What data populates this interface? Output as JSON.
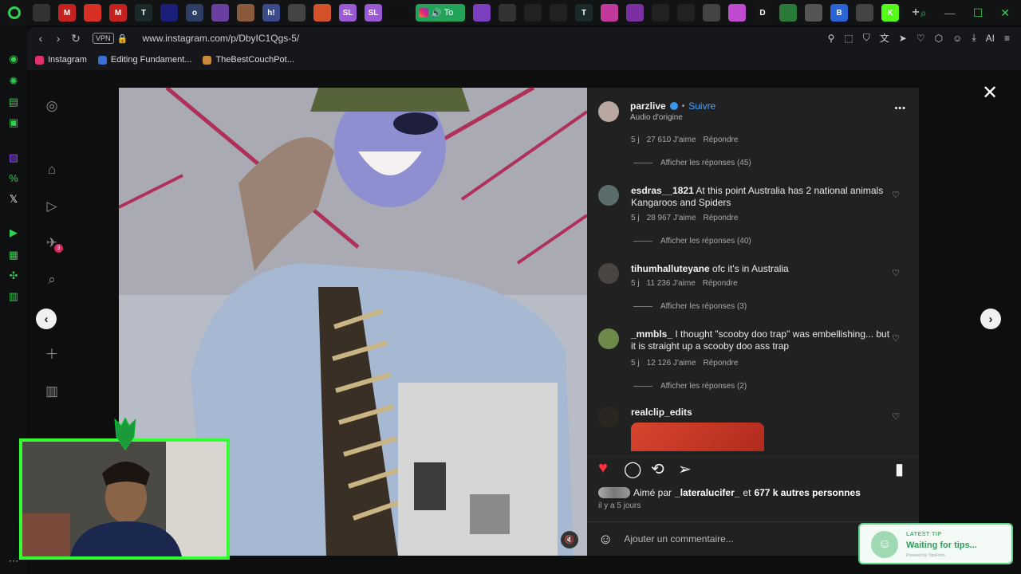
{
  "browser": {
    "url": "www.instagram.com/p/DbyIC1Qgs-5/",
    "vpn_label": "VPN",
    "ai_label": "AI",
    "active_tab_label": "To",
    "bookmarks": [
      {
        "label": "Instagram",
        "color": "#e1306c"
      },
      {
        "label": "Editing Fundament...",
        "color": "#3a6fd8"
      },
      {
        "label": "TheBestCouchPot...",
        "color": "#c98a3b"
      }
    ],
    "tab_icons": [
      {
        "label": "",
        "color": "#333"
      },
      {
        "label": "M",
        "color": "#c5221f"
      },
      {
        "label": "",
        "color": "#d93025"
      },
      {
        "label": "M",
        "color": "#c5221f"
      },
      {
        "label": "T",
        "color": "#1a2a2a"
      },
      {
        "label": "",
        "color": "#1b1f7a"
      },
      {
        "label": "o",
        "color": "#2c3e66"
      },
      {
        "label": "",
        "color": "#6b3fa0"
      },
      {
        "label": "",
        "color": "#8b5a3c"
      },
      {
        "label": "h!",
        "color": "#3a4a8a"
      },
      {
        "label": "",
        "color": "#444"
      },
      {
        "label": "",
        "color": "#d4522a"
      },
      {
        "label": "SL",
        "color": "#9b59d6"
      },
      {
        "label": "SL",
        "color": "#9b59d6"
      },
      {
        "label": "",
        "color": "#111"
      }
    ],
    "tab_icons_right": [
      {
        "label": "",
        "color": "#7b3fbf"
      },
      {
        "label": "",
        "color": "#333"
      },
      {
        "label": "",
        "color": "#222"
      },
      {
        "label": "",
        "color": "#222"
      },
      {
        "label": "T",
        "color": "#1a2a2a"
      },
      {
        "label": "",
        "color": "#c0399b"
      },
      {
        "label": "",
        "color": "#7b2fa0"
      },
      {
        "label": "",
        "color": "#222"
      },
      {
        "label": "",
        "color": "#222"
      },
      {
        "label": "",
        "color": "#444"
      },
      {
        "label": "",
        "color": "#c14bd0"
      },
      {
        "label": "D",
        "color": "#151515"
      },
      {
        "label": "",
        "color": "#2a7a3a"
      },
      {
        "label": "",
        "color": "#555"
      },
      {
        "label": "B",
        "color": "#2b63d9"
      },
      {
        "label": "",
        "color": "#444"
      },
      {
        "label": "K",
        "color": "#53fc18"
      }
    ]
  },
  "post": {
    "author": "parzlive",
    "follow_label": "Suivre",
    "audio_label": "Audio d'origine",
    "more_label": "•••",
    "top_meta": {
      "age": "5 j",
      "likes": "27 610 J'aime",
      "reply": "Répondre"
    },
    "top_replies": "Afficher les réponses (45)",
    "comments": [
      {
        "user": "esdras__1821",
        "text": "At this point Australia has 2 national animals Kangaroos and Spiders",
        "age": "5 j",
        "likes": "28 967 J'aime",
        "reply": "Répondre",
        "replies": "Afficher les réponses (40)"
      },
      {
        "user": "tihumhalluteyane",
        "text": "ofc it's in Australia",
        "age": "5 j",
        "likes": "11 236 J'aime",
        "reply": "Répondre",
        "replies": "Afficher les réponses (3)"
      },
      {
        "user": "_mmbls_",
        "text": "I thought \"scooby doo trap\" was embellishing... but it is straight up a scooby doo ass trap",
        "age": "5 j",
        "likes": "12 126 J'aime",
        "reply": "Répondre",
        "replies": "Afficher les réponses (2)"
      },
      {
        "user": "realclip_edits",
        "text": ""
      }
    ],
    "liked_by_prefix": "Aimé par",
    "liked_by_user": "_lateralucifer_",
    "liked_by_and": "et",
    "liked_by_others": "677 k autres personnes",
    "posted_ago": "il y a 5 jours",
    "comment_placeholder": "Ajouter un commentaire..."
  },
  "instagram_nav_badge": "3",
  "tip_widget": {
    "label": "LATEST TIP",
    "status": "Waiting for tips...",
    "powered": "Powered by TipsForm"
  },
  "colors": {
    "brand_green": "#2fd24f",
    "like_red": "#ff3040",
    "verified_blue": "#3897f0",
    "follow_blue": "#4aa3ff"
  }
}
